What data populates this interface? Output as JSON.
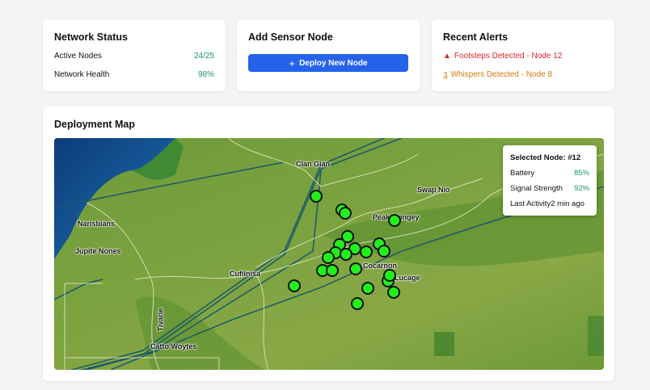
{
  "network_status": {
    "title": "Network Status",
    "active_nodes_label": "Active Nodes",
    "active_nodes": "24/25",
    "health_label": "Network Health",
    "health": "98%"
  },
  "add_node": {
    "title": "Add Sensor Node",
    "button_label": "Deploy New Node",
    "button_icon": "plus-icon"
  },
  "alerts": {
    "title": "Recent Alerts",
    "items": [
      {
        "icon": "warning-triangle-icon",
        "text": "Footsteps Detected - Node 12",
        "color": "#dc2626"
      },
      {
        "icon": "ear-icon",
        "text": "Whispers Detected - Node 8",
        "color": "#d97706"
      }
    ]
  },
  "map": {
    "title": "Deployment Map",
    "places": [
      "Clan Gian",
      "Swap Nio",
      "Narisbians",
      "Peak Mongey",
      "Jupite Nones",
      "Cufilnisa",
      "Cocarnon",
      "Lucage",
      "Tivarie",
      "Catto Woytes"
    ],
    "popup": {
      "title": "Selected Node: #12",
      "battery_label": "Battery",
      "battery": "85%",
      "signal_label": "Signal Strength",
      "signal": "92%",
      "activity_label": "Last Activity",
      "activity": "2 min ago"
    }
  }
}
